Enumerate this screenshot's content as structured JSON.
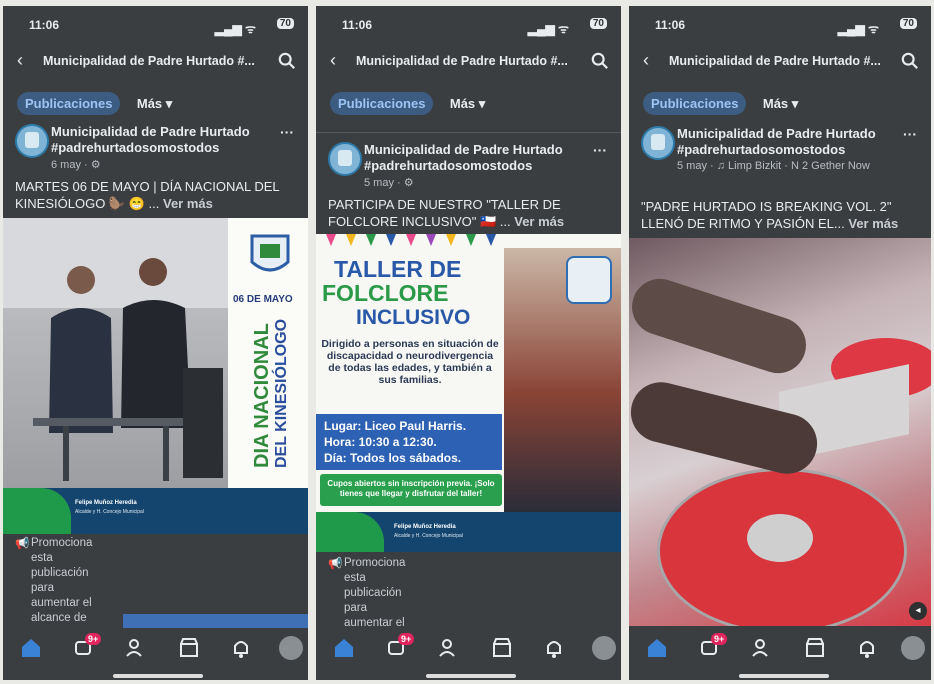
{
  "status": {
    "time": "11:06",
    "battery": "70"
  },
  "header": {
    "title": "Municipalidad de Padre Hurtado #..."
  },
  "tabs": {
    "publicaciones": "Publicaciones",
    "mas": "Más ▾"
  },
  "post_name": "Municipalidad de Padre Hurtado #padrehurtadosomostodos",
  "more": "Ver más",
  "promo": "Promociona esta publicación para aumentar el alcance de",
  "promo2": "Promociona esta publicación para aumentar el",
  "panels": [
    {
      "date": "6 may · ⚙",
      "text": "MARTES 06 DE MAYO | DÍA NACIONAL DEL KINESIÓLOGO 🦫 😁 ...",
      "poster": {
        "date": "06 DE MAYO",
        "line1": "DIA NACIONAL",
        "line2": "DEL KINESIÓLOGO",
        "footer_name": "Felipe Muñoz Heredia",
        "footer_sub": "Alcalde y H. Concejo Municipal"
      }
    },
    {
      "date": "5 may · ⚙",
      "text": "PARTICIPA DE NUESTRO \"TALLER DE FOLCLORE INCLUSIVO\" 🇨🇱 ...",
      "poster": {
        "t1": "TALLER DE",
        "t2": "FOLCLORE",
        "t3": "INCLUSIVO",
        "desc": "Dirigido a personas en situación de discapacidad o neurodivergencia de todas las edades, y también a sus familias.",
        "lugar": "Lugar: Liceo Paul Harris.",
        "hora": "Hora: 10:30 a 12:30.",
        "dia": "Día: Todos los sábados.",
        "cupos": "Cupos abiertos sin inscripción previa. ¡Solo tienes que llegar y disfrutar del taller!",
        "footer_name": "Felipe Muñoz Heredia",
        "footer_sub": "Alcalde y H. Concejo Municipal"
      }
    },
    {
      "date": "5 may · ♫ Limp Bizkit · N 2 Gether Now",
      "text": "\"PADRE HURTADO IS BREAKING VOL. 2\" LLENÓ DE RITMO Y PASIÓN EL...",
      "poster": {}
    }
  ],
  "nav": {
    "badge": "9+"
  },
  "icons": [
    "back-icon",
    "search-icon",
    "home-icon",
    "video-icon",
    "friends-icon",
    "marketplace-icon",
    "bell-icon",
    "profile-avatar"
  ],
  "colors": {
    "bg": "#3b3e41",
    "tab_bg": "#3d5c82",
    "tab_text": "#9cc4f4",
    "badge": "#e0245e"
  }
}
